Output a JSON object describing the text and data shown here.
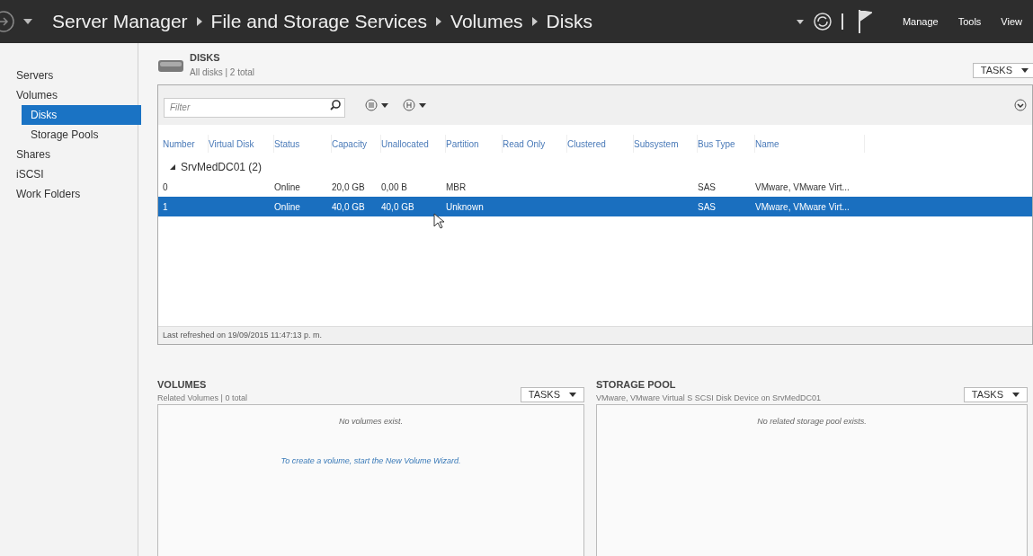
{
  "title_bar": {
    "breadcrumb": [
      "Server Manager",
      "File and Storage Services",
      "Volumes",
      "Disks"
    ],
    "menu": [
      "Manage",
      "Tools",
      "View"
    ]
  },
  "sidebar": {
    "items": [
      {
        "label": "Servers",
        "selected": false
      },
      {
        "label": "Volumes",
        "selected": false,
        "children": [
          {
            "label": "Disks",
            "selected": true
          },
          {
            "label": "Storage Pools",
            "selected": false
          }
        ]
      },
      {
        "label": "Shares",
        "selected": false
      },
      {
        "label": "iSCSI",
        "selected": false
      },
      {
        "label": "Work Folders",
        "selected": false
      }
    ]
  },
  "disks": {
    "title": "DISKS",
    "subtitle": "All disks | 2 total",
    "tasks": "TASKS",
    "filter": {
      "placeholder": "Filter"
    },
    "columns": [
      "Number",
      "Virtual Disk",
      "Status",
      "Capacity",
      "Unallocated",
      "Partition",
      "Read Only",
      "Clustered",
      "Subsystem",
      "Bus Type",
      "Name"
    ],
    "group": {
      "label": "SrvMedDC01 (2)",
      "expanded": true
    },
    "rows": [
      {
        "number": "0",
        "status": "Online",
        "capacity": "20,0 GB",
        "unallocated": "0,00 B",
        "partition": "MBR",
        "bus_type": "SAS",
        "name": "VMware, VMware Virt...",
        "selected": false
      },
      {
        "number": "1",
        "status": "Online",
        "capacity": "40,0 GB",
        "unallocated": "40,0 GB",
        "partition": "Unknown",
        "bus_type": "SAS",
        "name": "VMware, VMware Virt...",
        "selected": true
      }
    ],
    "footer": "Last refreshed on 19/09/2015 11:47:13 p. m."
  },
  "volumes": {
    "title": "VOLUMES",
    "subtitle": "Related Volumes | 0 total",
    "tasks": "TASKS",
    "message": "No volumes exist.",
    "link": "To create a volume, start the New Volume Wizard."
  },
  "storage_pool": {
    "title": "STORAGE POOL",
    "subtitle": "VMware, VMware Virtual S SCSI Disk Device on SrvMedDC01",
    "tasks": "TASKS",
    "message": "No related storage pool exists."
  }
}
